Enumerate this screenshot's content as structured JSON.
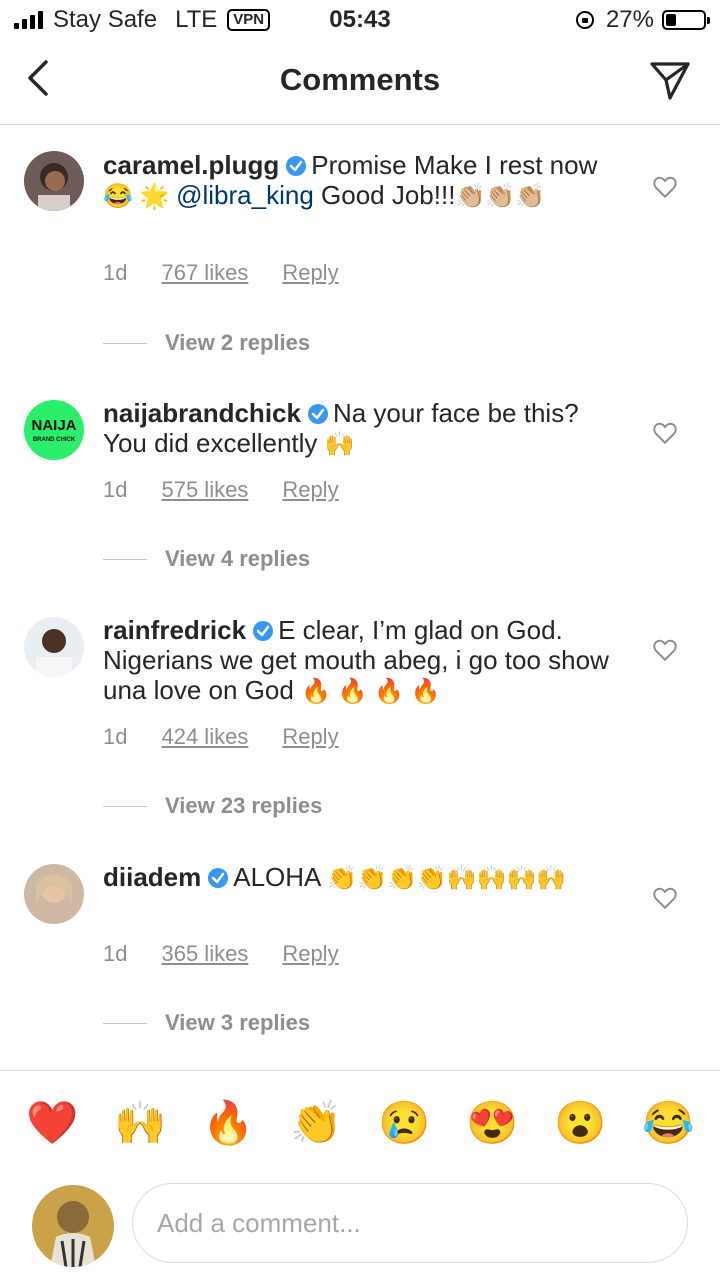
{
  "status_bar": {
    "carrier": "Stay Safe",
    "network": "LTE",
    "vpn": "VPN",
    "time": "05:43",
    "battery": "27%",
    "battery_level": 0.27
  },
  "header": {
    "title": "Comments",
    "back_icon": "chevron-left-icon",
    "share_icon": "paper-plane-icon"
  },
  "comments": [
    {
      "username": "caramel.plugg",
      "verified": true,
      "text_before": "Promise Make I rest now ",
      "emojis_before": "😂 🌟 ",
      "mention": "@libra_king",
      "text_after": " Good Job!!!",
      "emojis_after": "👏🏼👏🏼👏🏼",
      "age": "1d",
      "likes": "767 likes",
      "reply": "Reply",
      "view_replies": "View 2 replies"
    },
    {
      "username": "naijabrandchick",
      "verified": true,
      "avatar_text": "NAIJA",
      "avatar_subtext": "BRAND CHICK",
      "text": "Na your face be this? You did excellently ",
      "emojis": "🙌",
      "age": "1d",
      "likes": "575 likes",
      "reply": "Reply",
      "view_replies": "View 4 replies"
    },
    {
      "username": "rainfredrick",
      "verified": true,
      "text": "E clear, I’m glad on God. Nigerians we get mouth abeg, i go too show una love on God ",
      "emojis": "🔥 🔥 🔥 🔥",
      "age": "1d",
      "likes": "424 likes",
      "reply": "Reply",
      "view_replies": "View 23 replies"
    },
    {
      "username": "diiadem",
      "verified": true,
      "text": "ALOHA ",
      "emojis": "👏👏👏👏🙌🙌🙌🙌",
      "age": "1d",
      "likes": "365 likes",
      "reply": "Reply",
      "view_replies": "View 3 replies"
    }
  ],
  "emoji_bar": [
    "❤️",
    "🙌",
    "🔥",
    "👏",
    "😢",
    "😍",
    "😮",
    "😂"
  ],
  "composer": {
    "placeholder": "Add a comment..."
  },
  "colors": {
    "mention": "#00376b",
    "verified": "#3897f0",
    "muted": "#8e8e8e",
    "naija_avatar_bg": "#2bee6c"
  }
}
